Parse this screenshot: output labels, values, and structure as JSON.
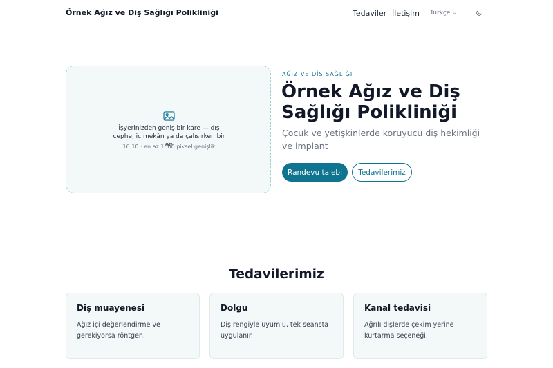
{
  "header": {
    "brand": "Örnek Ağız ve Diş Sağlığı Polikliniği",
    "nav": [
      "Tedaviler",
      "İletişim"
    ],
    "language": "Türkçe",
    "theme_icon": "moon-icon"
  },
  "hero": {
    "placeholder": {
      "icon": "image-icon",
      "text": "İşyerinizden geniş bir kare — dış cephe, iç mekân ya da çalışırken bir an",
      "hint": "16:10 · en az 1600 piksel genişlik"
    },
    "eyebrow": "AĞIZ VE DİŞ SAĞLIĞI",
    "title": "Örnek Ağız ve Diş Sağlığı Polikliniği",
    "subtitle": "Çocuk ve yetişkinlerde koruyucu diş hekimliği ve implant",
    "primary_button": "Randevu talebi",
    "secondary_button": "Tedavilerimiz"
  },
  "treatments": {
    "title": "Tedavilerimiz",
    "cards": [
      {
        "title": "Diş muayenesi",
        "text": "Ağız içi değerlendirme ve gerekiyorsa röntgen."
      },
      {
        "title": "Dolgu",
        "text": "Diş rengiyle uyumlu, tek seansta uygulanır."
      },
      {
        "title": "Kanal tedavisi",
        "text": "Ağrılı dişlerde çekim yerine kurtarma seçeneği."
      }
    ]
  },
  "colors": {
    "accent": "#0e7490",
    "card_bg": "#f3f9f9",
    "text": "#111827",
    "muted": "#6b7280"
  }
}
